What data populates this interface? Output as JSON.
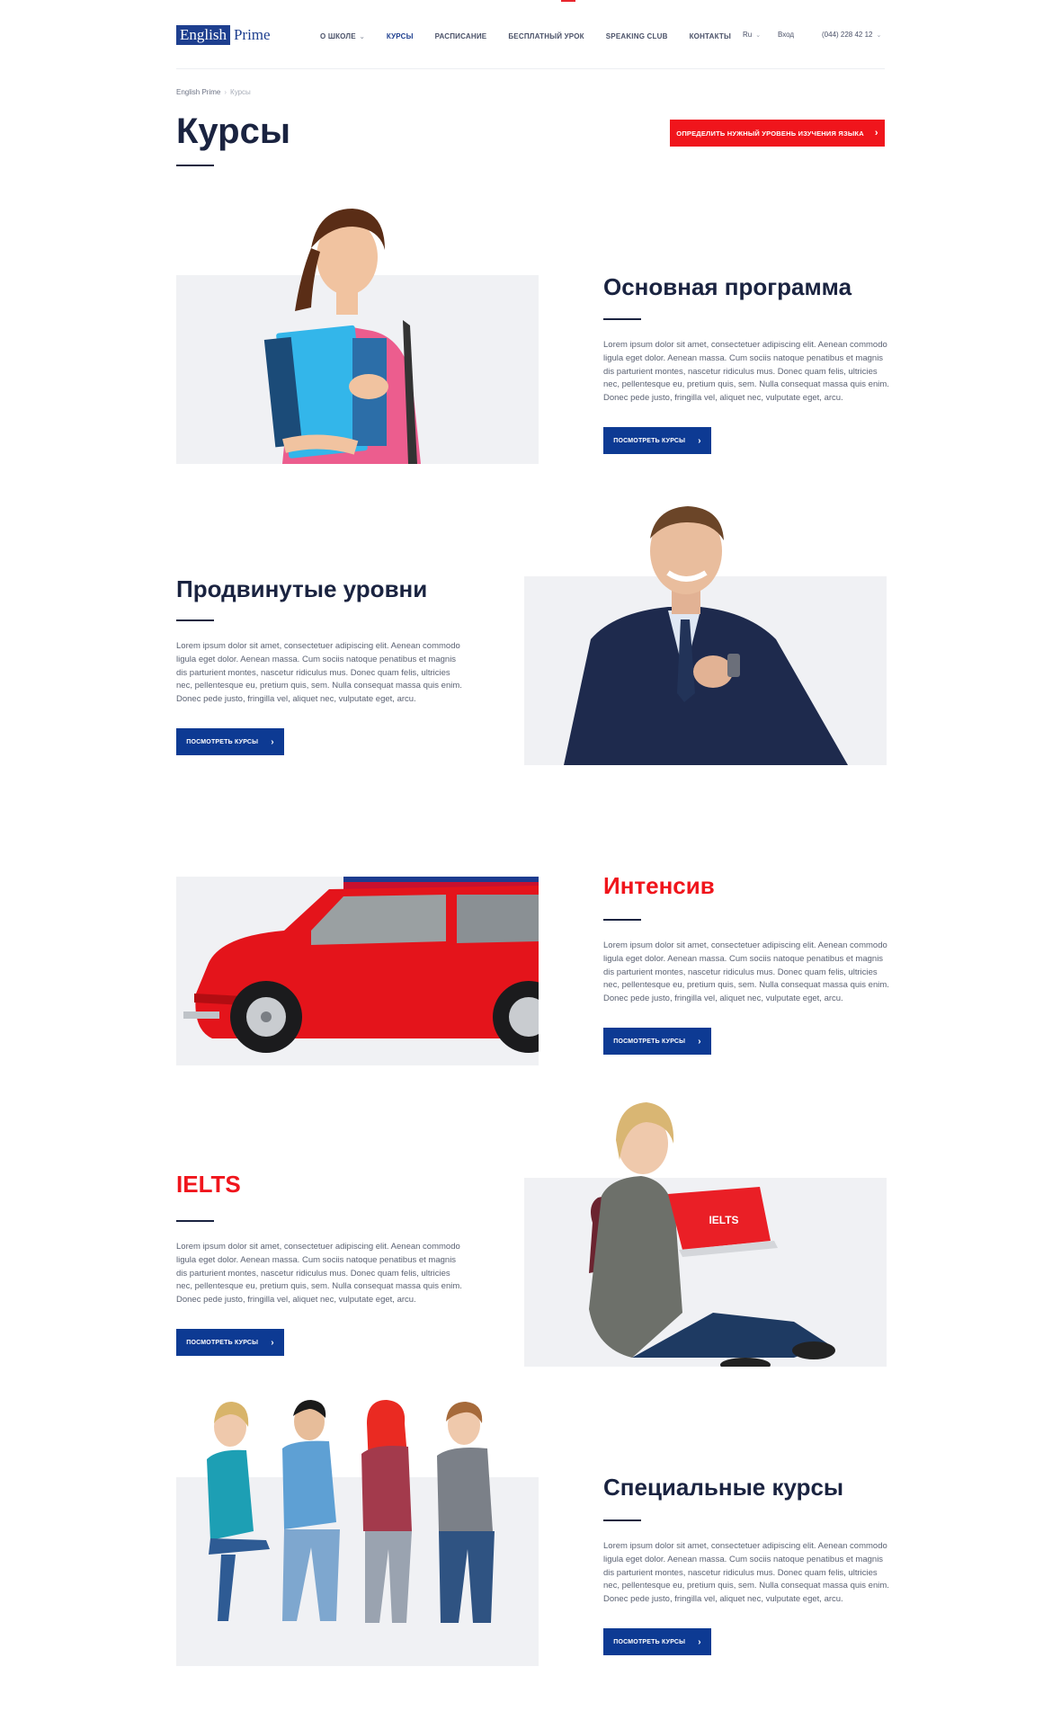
{
  "brand": {
    "logo_part1": "English",
    "logo_part2": "Prime"
  },
  "nav": [
    {
      "label": "О школе",
      "has_dropdown": true
    },
    {
      "label": "Курсы",
      "active": true
    },
    {
      "label": "Расписание"
    },
    {
      "label": "Бесплатный урок"
    },
    {
      "label": "Speaking club"
    },
    {
      "label": "Контакты"
    }
  ],
  "header": {
    "lang": "Ru",
    "login": "Вход",
    "phone": "(044) 228 42 12"
  },
  "breadcrumb": {
    "home": "English Prime",
    "current": "Курсы"
  },
  "page": {
    "title": "Курсы",
    "level_button": "Определить нужный уровень изучения языка"
  },
  "colors": {
    "accent_red": "#f0151c",
    "brand_blue": "#0d3a93",
    "dark": "#1a2340",
    "panel_bg": "#f0f1f4"
  },
  "courses": [
    {
      "title": "Основная программа",
      "title_color": "dark",
      "image": "student-girl-with-folders",
      "description": "Lorem ipsum dolor sit amet, consectetuer adipiscing elit. Aenean commodo ligula eget dolor. Aenean massa. Cum sociis natoque penatibus et magnis dis parturient montes, nascetur ridiculus mus. Donec quam felis, ultricies nec, pellentesque eu, pretium quis, sem. Nulla consequat massa quis enim. Donec pede justo, fringilla vel, aliquet nec, vulputate eget, arcu.",
      "button": "Посмотреть курсы"
    },
    {
      "title": "Продвинутые уровни",
      "title_color": "dark",
      "image": "businessman-in-suit",
      "description": "Lorem ipsum dolor sit amet, consectetuer adipiscing elit. Aenean commodo ligula eget dolor. Aenean massa. Cum sociis natoque penatibus et magnis dis parturient montes, nascetur ridiculus mus. Donec quam felis, ultricies nec, pellentesque eu, pretium quis, sem. Nulla consequat massa quis enim. Donec pede justo, fringilla vel, aliquet nec, vulputate eget, arcu.",
      "button": "Посмотреть курсы"
    },
    {
      "title": "Интенсив",
      "title_color": "red",
      "image": "red-mini-car",
      "description": "Lorem ipsum dolor sit amet, consectetuer adipiscing elit. Aenean commodo ligula eget dolor. Aenean massa. Cum sociis natoque penatibus et magnis dis parturient montes, nascetur ridiculus mus. Donec quam felis, ultricies nec, pellentesque eu, pretium quis, sem. Nulla consequat massa quis enim. Donec pede justo, fringilla vel, aliquet nec, vulputate eget, arcu.",
      "button": "Посмотреть курсы"
    },
    {
      "title": "IELTS",
      "title_color": "red",
      "image": "woman-with-laptop",
      "laptop_label": "IELTS",
      "description": "Lorem ipsum dolor sit amet, consectetuer adipiscing elit. Aenean commodo ligula eget dolor. Aenean massa. Cum sociis natoque penatibus et magnis dis parturient montes, nascetur ridiculus mus. Donec quam felis, ultricies nec, pellentesque eu, pretium quis, sem. Nulla consequat massa quis enim. Donec pede justo, fringilla vel, aliquet nec, vulputate eget, arcu.",
      "button": "Посмотреть курсы"
    },
    {
      "title": "Специальные курсы",
      "title_color": "dark",
      "image": "group-of-students",
      "description": "Lorem ipsum dolor sit amet, consectetuer adipiscing elit. Aenean commodo ligula eget dolor. Aenean massa. Cum sociis natoque penatibus et magnis dis parturient montes, nascetur ridiculus mus. Donec quam felis, ultricies nec, pellentesque eu, pretium quis, sem. Nulla consequat massa quis enim. Donec pede justo, fringilla vel, aliquet nec, vulputate eget, arcu.",
      "button": "Посмотреть курсы"
    }
  ]
}
